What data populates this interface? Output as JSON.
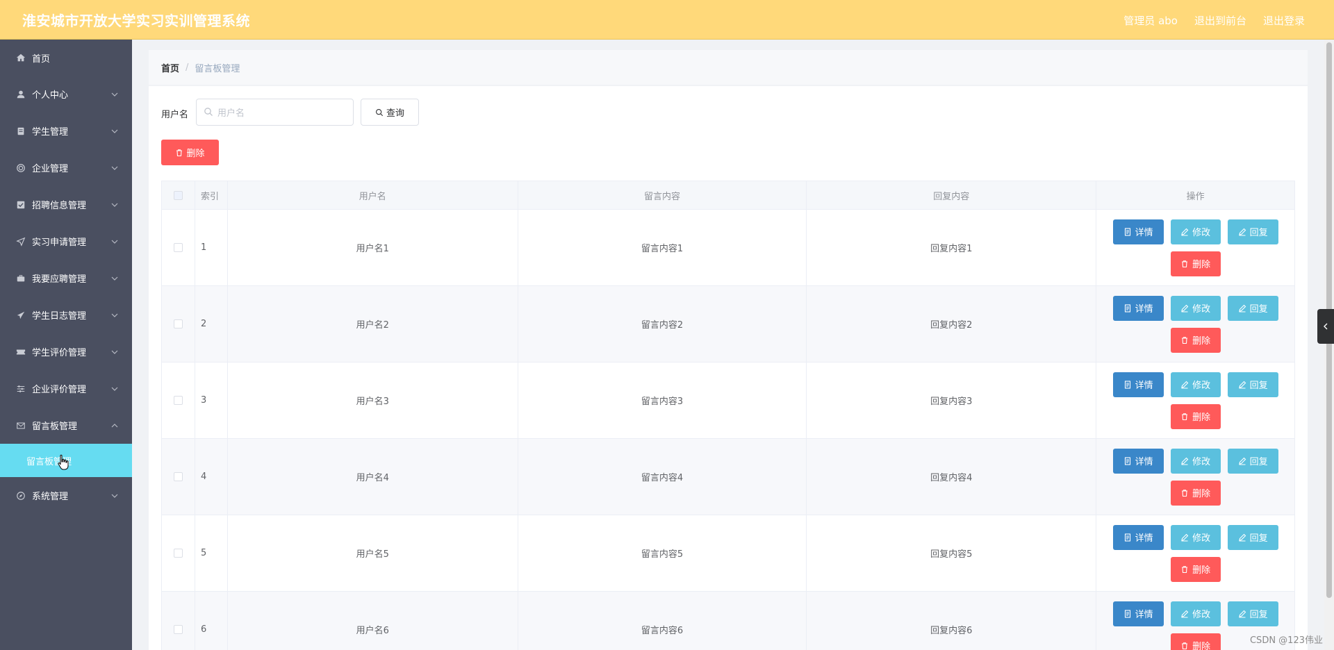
{
  "header": {
    "title": "淮安城市开放大学实习实训管理系统",
    "admin_label": "管理员 abo",
    "front_label": "退出到前台",
    "logout_label": "退出登录"
  },
  "sidebar": {
    "items": [
      {
        "label": "首页",
        "icon": "home-icon"
      },
      {
        "label": "个人中心",
        "icon": "user-icon"
      },
      {
        "label": "学生管理",
        "icon": "clipboard-icon"
      },
      {
        "label": "企业管理",
        "icon": "target-icon"
      },
      {
        "label": "招聘信息管理",
        "icon": "checkbox-icon"
      },
      {
        "label": "实习申请管理",
        "icon": "send-icon"
      },
      {
        "label": "我要应聘管理",
        "icon": "suitcase-icon"
      },
      {
        "label": "学生日志管理",
        "icon": "paper-plane-icon"
      },
      {
        "label": "学生评价管理",
        "icon": "ticket-icon"
      },
      {
        "label": "企业评价管理",
        "icon": "sliders-icon"
      },
      {
        "label": "留言板管理",
        "icon": "mail-icon"
      },
      {
        "label": "系统管理",
        "icon": "compass-icon"
      }
    ],
    "active_sub": "留言板管理"
  },
  "breadcrumb": {
    "home": "首页",
    "current": "留言板管理"
  },
  "search": {
    "label": "用户名",
    "placeholder": "用户名",
    "query_label": "查询",
    "delete_label": "删除"
  },
  "table": {
    "headers": {
      "index": "索引",
      "username": "用户名",
      "content": "留言内容",
      "reply": "回复内容",
      "ops": "操作"
    },
    "rows": [
      {
        "index": "1",
        "username": "用户名1",
        "content": "留言内容1",
        "reply": "回复内容1"
      },
      {
        "index": "2",
        "username": "用户名2",
        "content": "留言内容2",
        "reply": "回复内容2"
      },
      {
        "index": "3",
        "username": "用户名3",
        "content": "留言内容3",
        "reply": "回复内容3"
      },
      {
        "index": "4",
        "username": "用户名4",
        "content": "留言内容4",
        "reply": "回复内容4"
      },
      {
        "index": "5",
        "username": "用户名5",
        "content": "留言内容5",
        "reply": "回复内容5"
      },
      {
        "index": "6",
        "username": "用户名6",
        "content": "留言内容6",
        "reply": "回复内容6"
      }
    ],
    "actions": {
      "detail": "详情",
      "edit": "修改",
      "reply": "回复",
      "delete": "删除"
    }
  },
  "watermark": "CSDN @123伟业",
  "colors": {
    "header_bg": "#ffd97a",
    "sidebar_bg": "#4a4f60",
    "active_sub_bg": "#66dcf1",
    "danger": "#ff5a5a",
    "primary": "#3a87c9",
    "info": "#5bc0de"
  }
}
